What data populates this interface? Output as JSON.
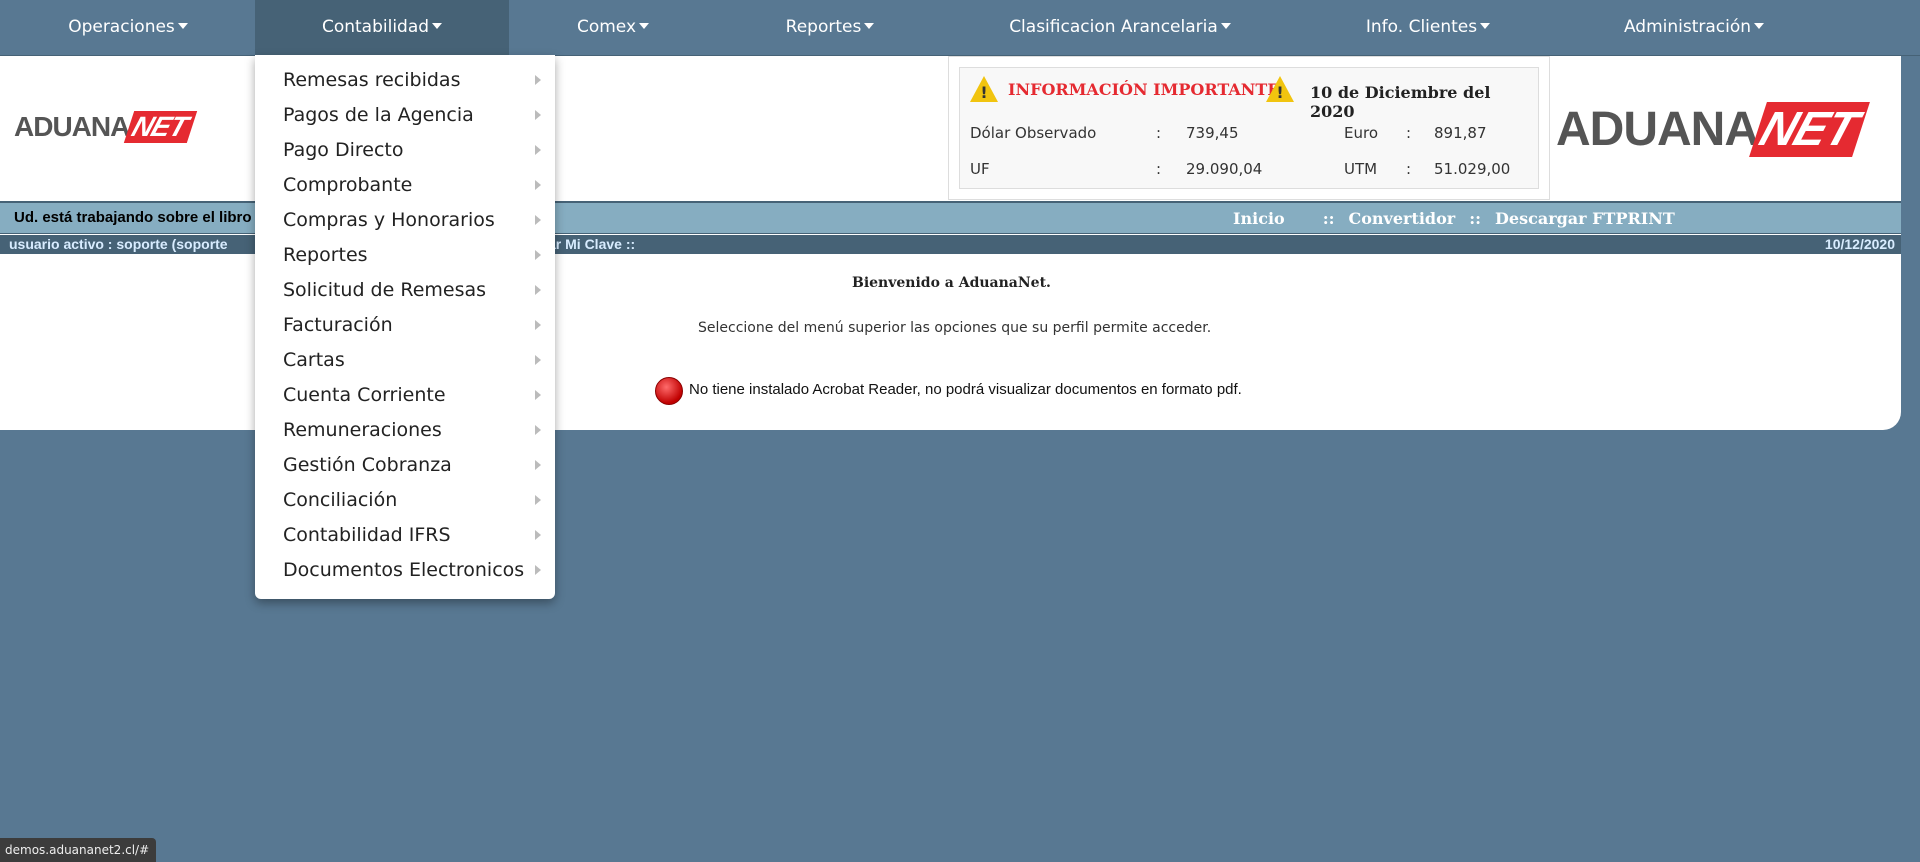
{
  "nav": {
    "items": [
      {
        "label": "Operaciones",
        "active": false
      },
      {
        "label": "Contabilidad",
        "active": true
      },
      {
        "label": "Comex",
        "active": false
      },
      {
        "label": "Reportes",
        "active": false
      },
      {
        "label": "Clasificacion Arancelaria",
        "active": false
      },
      {
        "label": "Info. Clientes",
        "active": false
      },
      {
        "label": "Administración",
        "active": false
      }
    ]
  },
  "logo": {
    "part1": "ADUANA",
    "part2": "NET"
  },
  "info": {
    "title": "INFORMACIÓN IMPORTANTE",
    "date": "10 de Diciembre del 2020",
    "warning_mark": "!",
    "indicators": [
      {
        "label": "Dólar Observado",
        "value": "739,45"
      },
      {
        "label": "Euro",
        "value": "891,87"
      },
      {
        "label": "UF",
        "value": "29.090,04"
      },
      {
        "label": "UTM",
        "value": "51.029,00"
      }
    ],
    "separator": ":"
  },
  "workbar": {
    "text": "Ud. está trabajando sobre el libro",
    "links": [
      "Inicio",
      "Convertidor",
      "Descargar FTPRINT"
    ],
    "separator": "::"
  },
  "userbar": {
    "text": "usuario activo : soporte  (soporte",
    "mi_clave": "ar Mi Clave ::",
    "date": "10/12/2020"
  },
  "main": {
    "welcome": "Bienvenido a AduanaNet.",
    "instruction": "Seleccione del menú superior las opciones que su perfil permite acceder.",
    "acrobat": "No tiene instalado Acrobat Reader, no podrá visualizar documentos en formato pdf."
  },
  "dropdown": {
    "items": [
      "Remesas recibidas",
      "Pagos de la Agencia",
      "Pago Directo",
      "Comprobante",
      "Compras y Honorarios",
      "Reportes",
      "Solicitud de Remesas",
      "Facturación",
      "Cartas",
      "Cuenta Corriente",
      "Remuneraciones",
      "Gestión Cobranza",
      "Conciliación",
      "Contabilidad IFRS",
      "Documentos Electronicos"
    ]
  },
  "statusbar": {
    "url": "demos.aduananet2.cl/#"
  },
  "colors": {
    "nav_bg": "#587892",
    "nav_active": "#466276",
    "accent_red": "#e52a31",
    "workbar": "#86adc1"
  }
}
